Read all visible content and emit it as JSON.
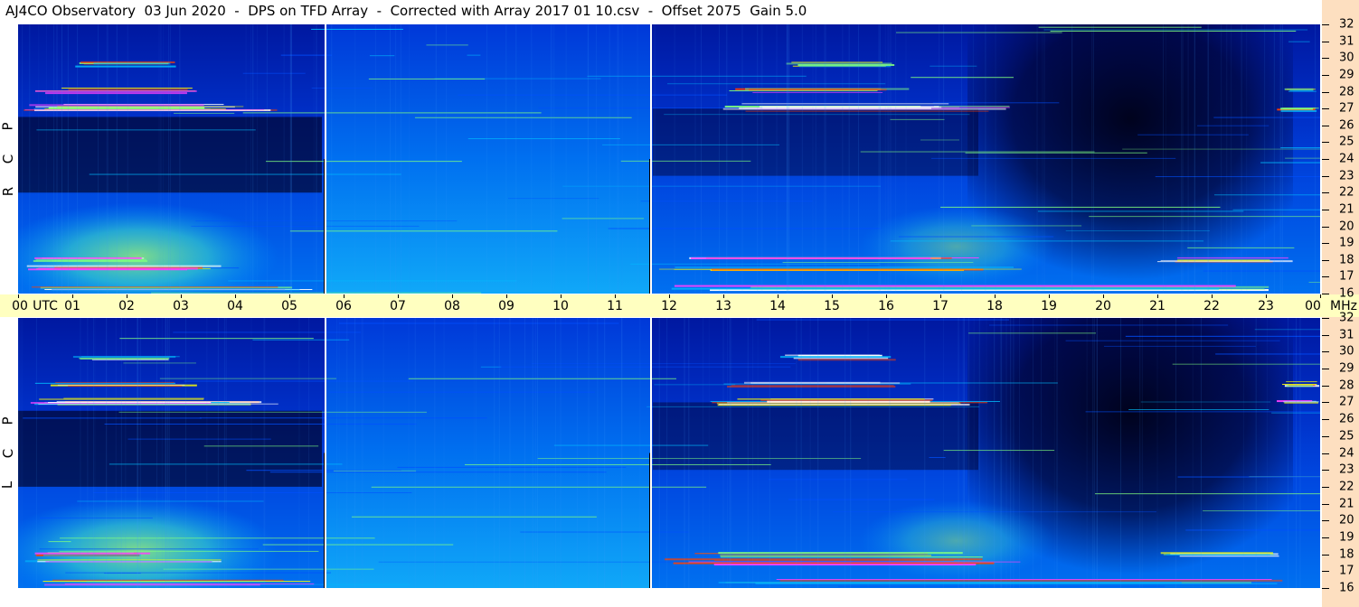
{
  "title": "AJ4CO Observatory  03 Jun 2020  -  DPS on TFD Array  -  Corrected with Array 2017 01 10.csv  -  Offset 2075  Gain 5.0",
  "chart_data": [
    {
      "type": "heatmap",
      "panel": "RCP",
      "polarization_letters": [
        "R",
        "C",
        "P"
      ],
      "x_unit": "UTC",
      "x_ticks": [
        "00",
        "01",
        "02",
        "03",
        "04",
        "05",
        "06",
        "07",
        "08",
        "09",
        "10",
        "11",
        "12",
        "13",
        "14",
        "15",
        "16",
        "17",
        "18",
        "19",
        "20",
        "21",
        "22",
        "23",
        "00"
      ],
      "x_range_hours": [
        0,
        24
      ],
      "y_unit": "MHz",
      "y_ticks": [
        "32",
        "31",
        "30",
        "29",
        "28",
        "27",
        "26",
        "25",
        "24",
        "23",
        "22",
        "21",
        "20",
        "19",
        "18",
        "17",
        "16"
      ],
      "y_range_mhz": [
        16,
        32
      ],
      "gap_lines_hours": [
        5.65,
        11.65
      ],
      "bright_bands_mhz": [
        27.0,
        28.2,
        17.5,
        18.0
      ],
      "colormap": [
        "#000010",
        "#0000a0",
        "#0050ff",
        "#00c0ff",
        "#80ff80",
        "#ffff00",
        "#ff4000",
        "#ff40ff",
        "#ffffff"
      ]
    },
    {
      "type": "heatmap",
      "panel": "LCP",
      "polarization_letters": [
        "L",
        "C",
        "P"
      ],
      "x_unit": "UTC",
      "x_ticks": [
        "00",
        "01",
        "02",
        "03",
        "04",
        "05",
        "06",
        "07",
        "08",
        "09",
        "10",
        "11",
        "12",
        "13",
        "14",
        "15",
        "16",
        "17",
        "18",
        "19",
        "20",
        "21",
        "22",
        "23",
        "00"
      ],
      "x_range_hours": [
        0,
        24
      ],
      "y_unit": "MHz",
      "y_ticks": [
        "32",
        "31",
        "30",
        "29",
        "28",
        "27",
        "26",
        "25",
        "24",
        "23",
        "22",
        "21",
        "20",
        "19",
        "18",
        "17",
        "16"
      ],
      "y_range_mhz": [
        16,
        32
      ],
      "gap_lines_hours": [
        5.65,
        11.65
      ],
      "bright_bands_mhz": [
        27.0,
        28.2,
        17.5,
        18.0
      ],
      "colormap": [
        "#000010",
        "#0000a0",
        "#0050ff",
        "#00c0ff",
        "#80ff80",
        "#ffff00",
        "#ff4000",
        "#ff40ff",
        "#ffffff"
      ]
    }
  ],
  "axis": {
    "utc_label": "UTC",
    "mhz_label": "MHz"
  }
}
